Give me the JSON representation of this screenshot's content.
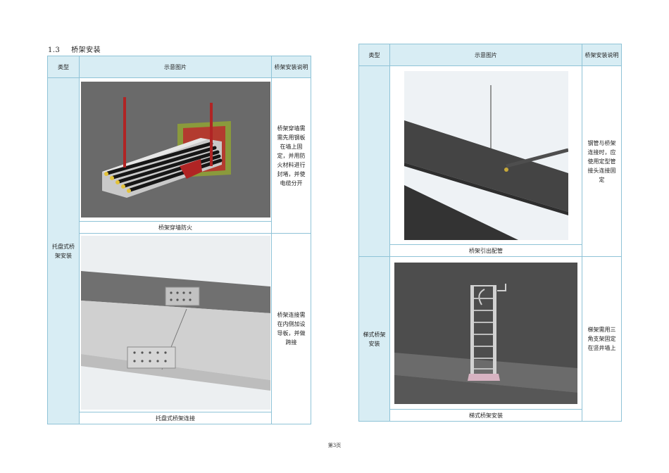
{
  "section": {
    "number": "1.3",
    "title": "桥架安装"
  },
  "left_table": {
    "headers": {
      "type": "类型",
      "image": "示意图片",
      "desc": "桥架安装说明"
    },
    "type_label": "托盘式桥架安装",
    "rows": [
      {
        "caption": "桥架穿墙防火",
        "desc": "桥架穿墙需需先用钢板在墙上固定，并用防火材料进行封堵，并使电缆分开"
      },
      {
        "caption": "托盘式桥架连接",
        "desc": "桥架连接需在内侧加设导板，并做跨接"
      }
    ]
  },
  "right_table": {
    "headers": {
      "type": "类型",
      "image": "示意图片",
      "desc": "桥架安装说明"
    },
    "rows": [
      {
        "type_label": "",
        "caption": "桥架引出配管",
        "desc": "钢管与桥架连接时，应使用定型管接头连接固定"
      },
      {
        "type_label": "梯式桥架安装",
        "caption": "梯式桥架安装",
        "desc": "梯架需用三角支架固定在竖井墙上"
      }
    ]
  },
  "footer": {
    "page": "第3页"
  }
}
